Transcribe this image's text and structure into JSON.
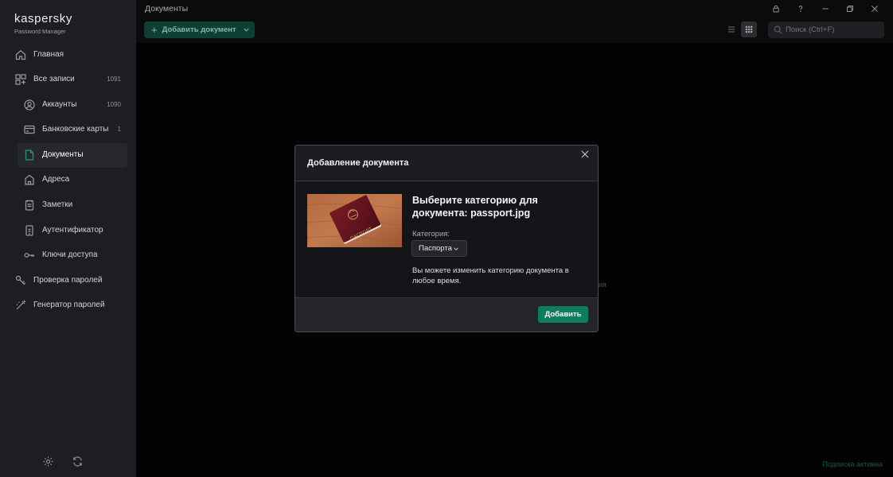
{
  "app": {
    "logo_name": "kaspersky",
    "logo_product": "Password Manager",
    "page_title": "Документы"
  },
  "sidebar": {
    "items": [
      {
        "label": "Главная",
        "icon": "home-icon"
      },
      {
        "label": "Все записи",
        "count": "1091",
        "icon": "grid-icon"
      },
      {
        "label": "Аккаунты",
        "count": "1090",
        "icon": "user-circle-icon"
      },
      {
        "label": "Банковские карты",
        "count": "1",
        "icon": "card-icon"
      },
      {
        "label": "Документы",
        "icon": "document-icon"
      },
      {
        "label": "Адреса",
        "icon": "home-address-icon"
      },
      {
        "label": "Заметки",
        "icon": "note-icon"
      },
      {
        "label": "Аутентификатор",
        "icon": "authenticator-icon"
      },
      {
        "label": "Ключи доступа",
        "icon": "key-icon"
      },
      {
        "label": "Проверка паролей",
        "icon": "password-check-icon"
      },
      {
        "label": "Генератор паролей",
        "icon": "password-generator-icon"
      }
    ],
    "active_label": "Документы"
  },
  "toolbar": {
    "add_document_label": "Добавить документ",
    "search_placeholder": "Поиск (Ctrl+F)"
  },
  "main": {
    "background_hint": "ия",
    "subscription_status": "Подписка активна"
  },
  "modal": {
    "title": "Добавление документа",
    "choose_title": "Выберите категорию для документа: passport.jpg",
    "category_label": "Категория:",
    "category_value": "Паспорта",
    "hint": "Вы можете изменить категорию документа в любое время.",
    "add_button": "Добавить",
    "thumbnail_cover_text": "ПАСПОРТ"
  },
  "colors": {
    "sidebar_bg": "#1d1e21",
    "main_bg": "#020203",
    "accent_green": "#0f7c5f",
    "dim_green": "#0f3f33",
    "modal_bg": "#1c1d21"
  }
}
